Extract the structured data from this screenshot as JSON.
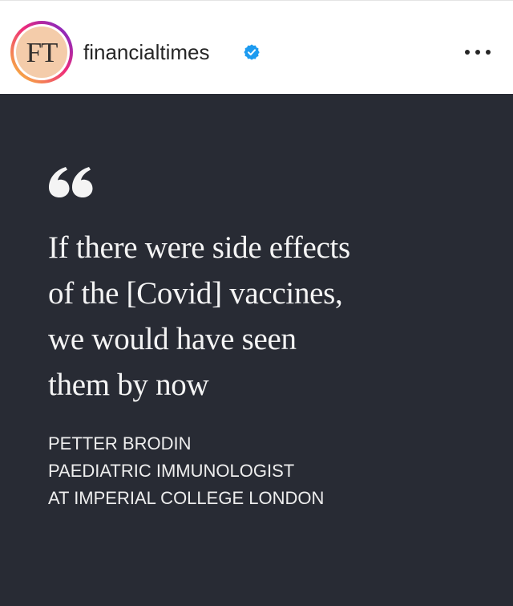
{
  "post": {
    "username": "financialtimes",
    "verified": true,
    "avatar_text": "FT",
    "avatar_color": "#f4ccaa",
    "more_icon": "ellipsis-icon",
    "verified_icon": "verified-badge-icon"
  },
  "quote": {
    "mark_icon": "quotation-mark-icon",
    "lines": [
      "If there were side effects",
      "of the [Covid] vaccines,",
      "we would have seen",
      "them by now"
    ],
    "attribution": [
      "PETTER BRODIN",
      "PAEDIATRIC IMMUNOLOGIST",
      "AT IMPERIAL COLLEGE LONDON"
    ],
    "background_color": "#282b34"
  },
  "colors": {
    "verified_blue": "#1d9bf0",
    "text_dark": "#262626"
  }
}
